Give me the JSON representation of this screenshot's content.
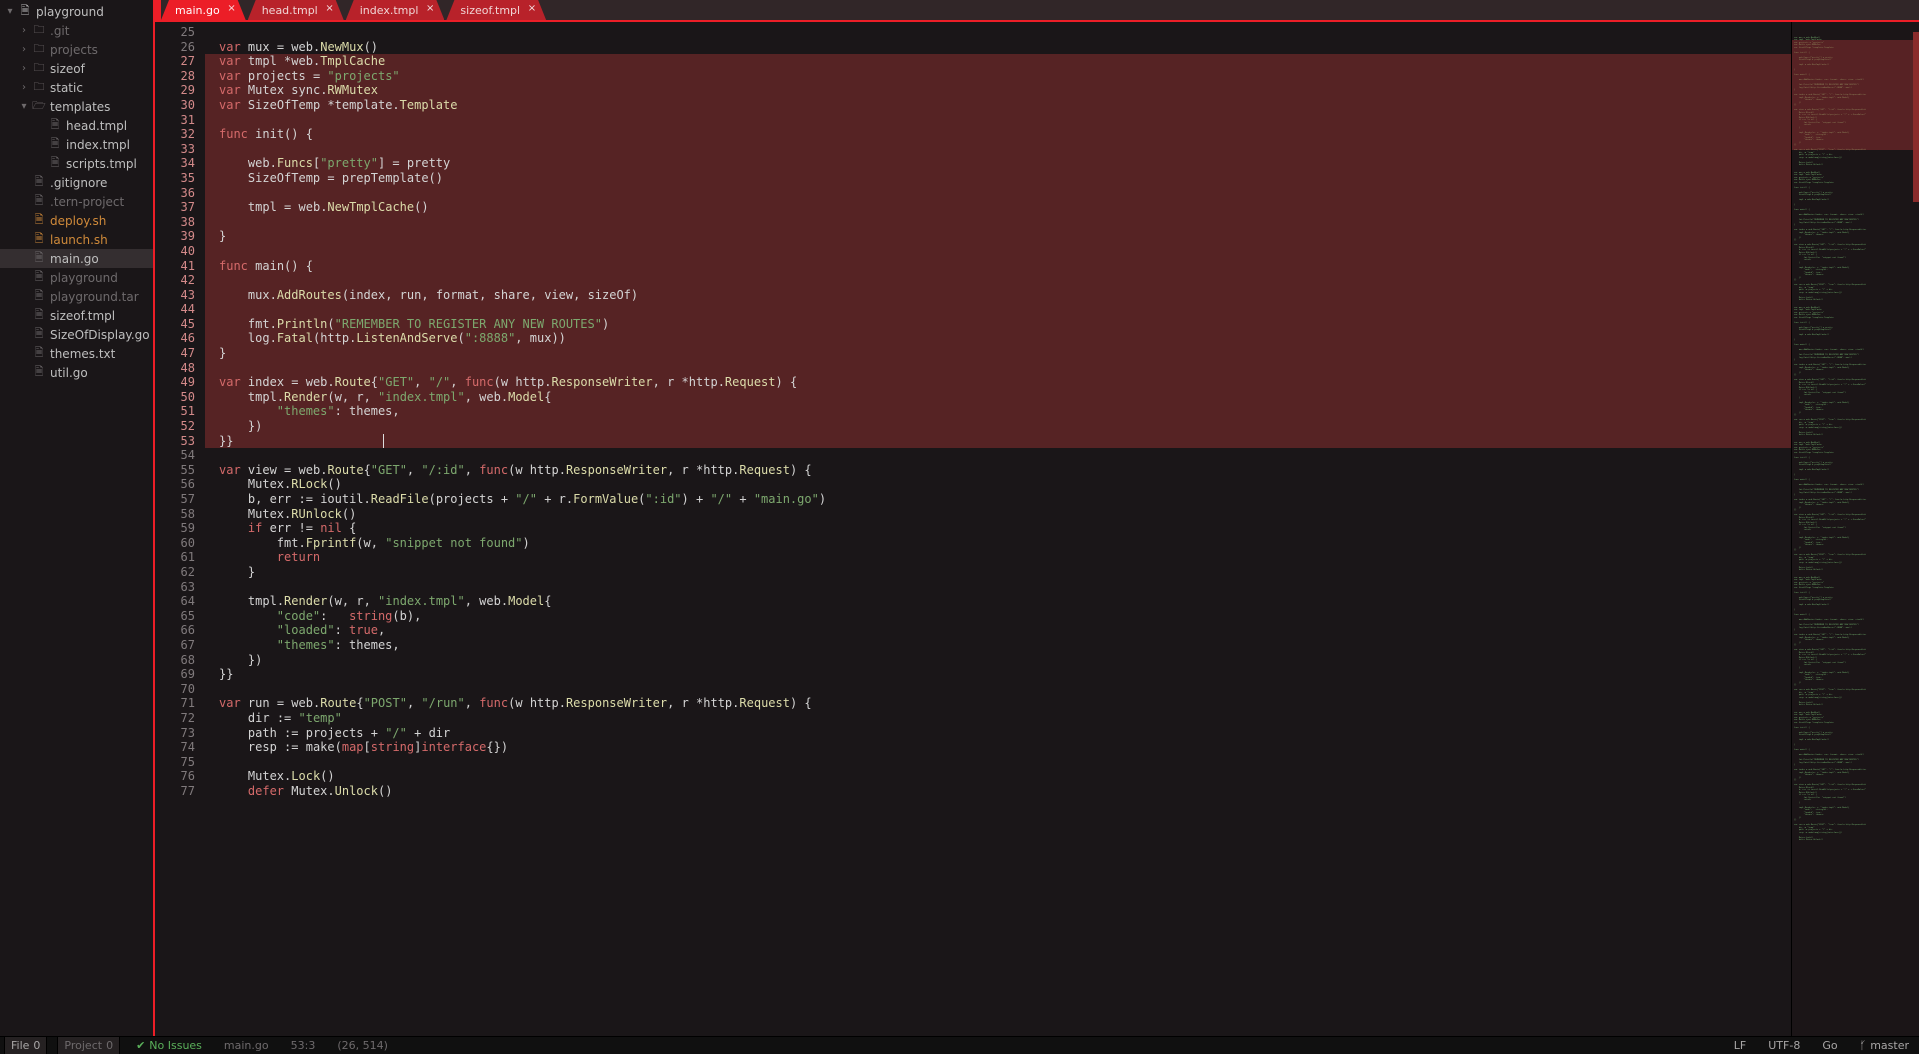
{
  "tree": {
    "root": "playground",
    "items": [
      {
        "name": ".git",
        "type": "folder",
        "state": "closed",
        "muted": true,
        "depth": 2,
        "arrow": ">"
      },
      {
        "name": "projects",
        "type": "folder",
        "state": "closed",
        "muted": true,
        "depth": 2,
        "arrow": ">"
      },
      {
        "name": "sizeof",
        "type": "folder",
        "state": "closed",
        "muted": false,
        "depth": 2,
        "arrow": ">"
      },
      {
        "name": "static",
        "type": "folder",
        "state": "closed",
        "muted": false,
        "depth": 2,
        "arrow": ">"
      },
      {
        "name": "templates",
        "type": "folder",
        "state": "open",
        "muted": false,
        "depth": 2,
        "arrow": "v"
      },
      {
        "name": "head.tmpl",
        "type": "file",
        "depth": 3
      },
      {
        "name": "index.tmpl",
        "type": "file",
        "depth": 3
      },
      {
        "name": "scripts.tmpl",
        "type": "file",
        "depth": 3
      },
      {
        "name": ".gitignore",
        "type": "file",
        "depth": 2
      },
      {
        "name": ".tern-project",
        "type": "file",
        "depth": 2,
        "muted": true
      },
      {
        "name": "deploy.sh",
        "type": "script",
        "depth": 2,
        "orange": true
      },
      {
        "name": "launch.sh",
        "type": "script",
        "depth": 2,
        "orange": true
      },
      {
        "name": "main.go",
        "type": "file",
        "depth": 2,
        "active": true
      },
      {
        "name": "playground",
        "type": "file",
        "depth": 2,
        "muted": true
      },
      {
        "name": "playground.tar",
        "type": "file",
        "depth": 2,
        "muted": true
      },
      {
        "name": "sizeof.tmpl",
        "type": "file",
        "depth": 2
      },
      {
        "name": "SizeOfDisplay.go",
        "type": "file",
        "depth": 2
      },
      {
        "name": "themes.txt",
        "type": "file",
        "depth": 2
      },
      {
        "name": "util.go",
        "type": "file",
        "depth": 2
      }
    ]
  },
  "tabs": [
    {
      "label": "main.go",
      "active": true
    },
    {
      "label": "head.tmpl",
      "active": false
    },
    {
      "label": "index.tmpl",
      "active": false
    },
    {
      "label": "sizeof.tmpl",
      "active": false
    }
  ],
  "editor": {
    "first_line": 25,
    "selection_start": 27,
    "selection_end": 53,
    "cursor_line": 53,
    "lines": [
      {
        "n": 25,
        "raw": ""
      },
      {
        "n": 26,
        "raw": "var mux = web.NewMux()"
      },
      {
        "n": 27,
        "raw": "var tmpl *web.TmplCache"
      },
      {
        "n": 28,
        "raw": "var projects = \"projects\""
      },
      {
        "n": 29,
        "raw": "var Mutex sync.RWMutex"
      },
      {
        "n": 30,
        "raw": "var SizeOfTemp *template.Template"
      },
      {
        "n": 31,
        "raw": ""
      },
      {
        "n": 32,
        "raw": "func init() {"
      },
      {
        "n": 33,
        "raw": ""
      },
      {
        "n": 34,
        "raw": "    web.Funcs[\"pretty\"] = pretty"
      },
      {
        "n": 35,
        "raw": "    SizeOfTemp = prepTemplate()"
      },
      {
        "n": 36,
        "raw": ""
      },
      {
        "n": 37,
        "raw": "    tmpl = web.NewTmplCache()"
      },
      {
        "n": 38,
        "raw": ""
      },
      {
        "n": 39,
        "raw": "}"
      },
      {
        "n": 40,
        "raw": ""
      },
      {
        "n": 41,
        "raw": "func main() {"
      },
      {
        "n": 42,
        "raw": ""
      },
      {
        "n": 43,
        "raw": "    mux.AddRoutes(index, run, format, share, view, sizeOf)"
      },
      {
        "n": 44,
        "raw": ""
      },
      {
        "n": 45,
        "raw": "    fmt.Println(\"REMEMBER TO REGISTER ANY NEW ROUTES\")"
      },
      {
        "n": 46,
        "raw": "    log.Fatal(http.ListenAndServe(\":8888\", mux))"
      },
      {
        "n": 47,
        "raw": "}"
      },
      {
        "n": 48,
        "raw": ""
      },
      {
        "n": 49,
        "raw": "var index = web.Route{\"GET\", \"/\", func(w http.ResponseWriter, r *http.Request) {"
      },
      {
        "n": 50,
        "raw": "    tmpl.Render(w, r, \"index.tmpl\", web.Model{"
      },
      {
        "n": 51,
        "raw": "        \"themes\": themes,"
      },
      {
        "n": 52,
        "raw": "    })"
      },
      {
        "n": 53,
        "raw": "}}"
      },
      {
        "n": 54,
        "raw": ""
      },
      {
        "n": 55,
        "raw": "var view = web.Route{\"GET\", \"/:id\", func(w http.ResponseWriter, r *http.Request) {"
      },
      {
        "n": 56,
        "raw": "    Mutex.RLock()"
      },
      {
        "n": 57,
        "raw": "    b, err := ioutil.ReadFile(projects + \"/\" + r.FormValue(\":id\") + \"/\" + \"main.go\")"
      },
      {
        "n": 58,
        "raw": "    Mutex.RUnlock()"
      },
      {
        "n": 59,
        "raw": "    if err != nil {"
      },
      {
        "n": 60,
        "raw": "        fmt.Fprintf(w, \"snippet not found\")"
      },
      {
        "n": 61,
        "raw": "        return"
      },
      {
        "n": 62,
        "raw": "    }"
      },
      {
        "n": 63,
        "raw": ""
      },
      {
        "n": 64,
        "raw": "    tmpl.Render(w, r, \"index.tmpl\", web.Model{"
      },
      {
        "n": 65,
        "raw": "        \"code\":   string(b),"
      },
      {
        "n": 66,
        "raw": "        \"loaded\": true,"
      },
      {
        "n": 67,
        "raw": "        \"themes\": themes,"
      },
      {
        "n": 68,
        "raw": "    })"
      },
      {
        "n": 69,
        "raw": "}}"
      },
      {
        "n": 70,
        "raw": ""
      },
      {
        "n": 71,
        "raw": "var run = web.Route{\"POST\", \"/run\", func(w http.ResponseWriter, r *http.Request) {"
      },
      {
        "n": 72,
        "raw": "    dir := \"temp\""
      },
      {
        "n": 73,
        "raw": "    path := projects + \"/\" + dir"
      },
      {
        "n": 74,
        "raw": "    resp := make(map[string]interface{})"
      },
      {
        "n": 75,
        "raw": ""
      },
      {
        "n": 76,
        "raw": "    Mutex.Lock()"
      },
      {
        "n": 77,
        "raw": "    defer Mutex.Unlock()"
      }
    ]
  },
  "status": {
    "file_count_label": "File",
    "file_count": "0",
    "project_count_label": "Project",
    "project_count": "0",
    "issues_icon": "✔",
    "issues_text": "No Issues",
    "filename": "main.go",
    "cursor_pos": "53:3",
    "selection": "(26, 514)",
    "line_ending": "LF",
    "encoding": "UTF-8",
    "language": "Go",
    "branch_icon": "ᚶ",
    "branch": "master"
  }
}
